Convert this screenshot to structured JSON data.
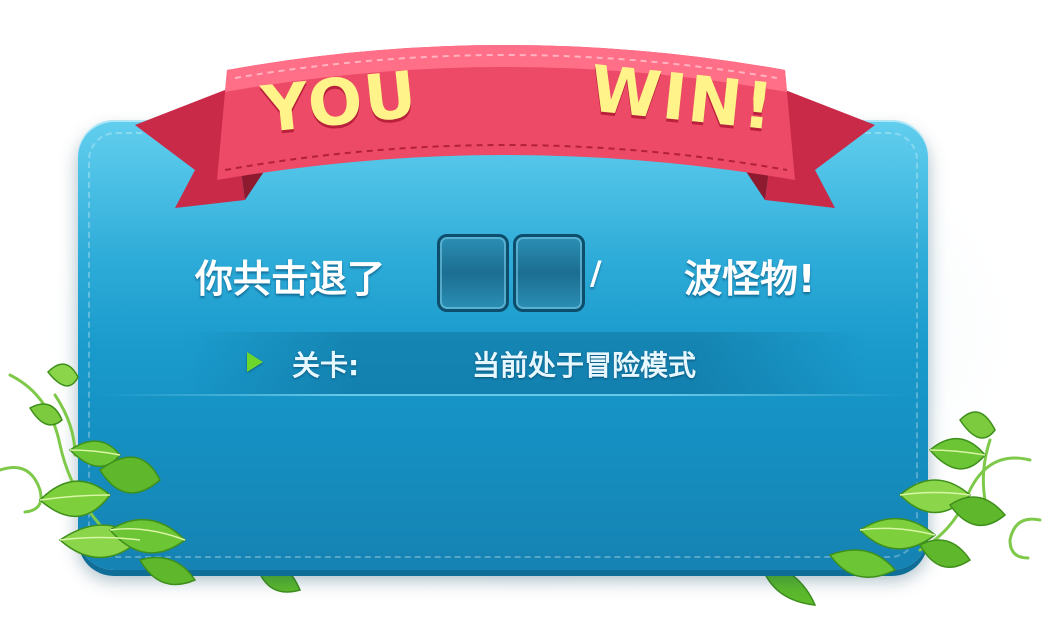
{
  "result": {
    "word_you": "YOU",
    "word_win": "WIN!"
  },
  "waves": {
    "prefix": "你共击退了",
    "current_digits": [
      "",
      ""
    ],
    "separator": "/",
    "total": "",
    "suffix": "波怪物!"
  },
  "level": {
    "label": "关卡:",
    "name": "",
    "mode": "当前处于冒险模式"
  },
  "colors": {
    "panel": "#1fa6d6",
    "ribbon": "#e8415e",
    "title_text": "#fff38a",
    "arrow": "#6cd62c",
    "leaf": "#6cc534"
  },
  "icons": [
    "play-arrow-icon",
    "leaf-vine-left-icon",
    "leaf-vine-right-icon",
    "ribbon-banner-icon"
  ]
}
